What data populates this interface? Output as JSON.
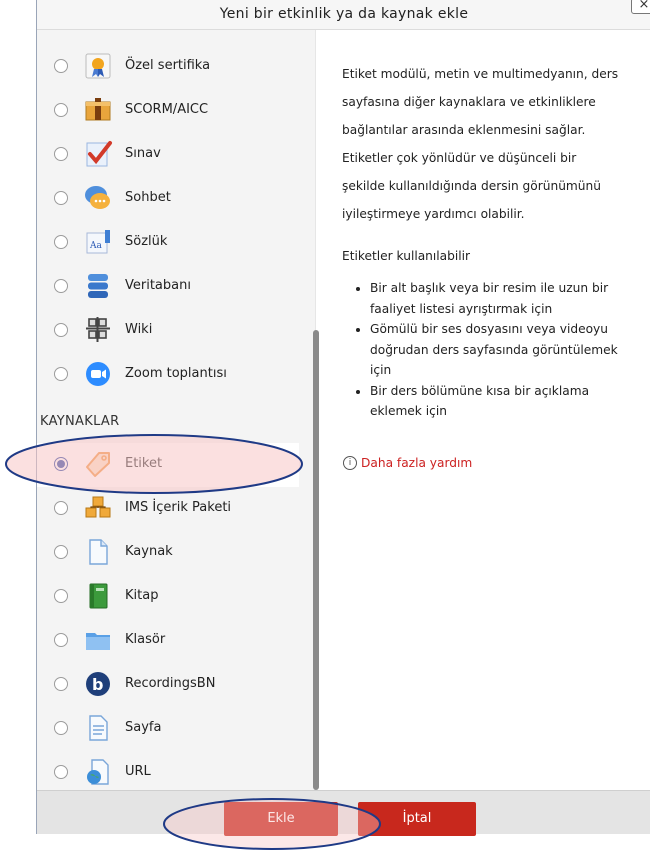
{
  "dialog": {
    "title": "Yeni bir etkinlik ya da kaynak ekle",
    "close_label": "×"
  },
  "list": {
    "activities": [
      {
        "label": "Özel sertifika",
        "icon": "certificate-icon"
      },
      {
        "label": "SCORM/AICC",
        "icon": "scorm-package-icon"
      },
      {
        "label": "Sınav",
        "icon": "quiz-checkmark-icon"
      },
      {
        "label": "Sohbet",
        "icon": "chat-bubbles-icon"
      },
      {
        "label": "Sözlük",
        "icon": "glossary-icon"
      },
      {
        "label": "Veritabanı",
        "icon": "database-icon"
      },
      {
        "label": "Wiki",
        "icon": "wiki-icon"
      },
      {
        "label": "Zoom toplantısı",
        "icon": "zoom-camera-icon"
      }
    ],
    "resources_heading": "KAYNAKLAR",
    "resources": [
      {
        "label": "Etiket",
        "icon": "label-tag-icon",
        "selected": true
      },
      {
        "label": "IMS İçerik Paketi",
        "icon": "ims-package-icon"
      },
      {
        "label": "Kaynak",
        "icon": "file-icon"
      },
      {
        "label": "Kitap",
        "icon": "book-icon"
      },
      {
        "label": "Klasör",
        "icon": "folder-icon"
      },
      {
        "label": "RecordingsBN",
        "icon": "bigbluebutton-icon"
      },
      {
        "label": "Sayfa",
        "icon": "page-icon"
      },
      {
        "label": "URL",
        "icon": "url-globe-icon"
      }
    ]
  },
  "description": {
    "p1": "Etiket modülü, metin ve multimedyanın, ders sayfasına diğer kaynaklara ve etkinliklere bağlantılar arasında eklenmesini sağlar. Etiketler çok yönlüdür ve düşünceli bir şekilde kullanıldığında dersin görünümünü iyileştirmeye yardımcı olabilir.",
    "p2": "Etiketler kullanılabilir",
    "bullets": [
      "Bir alt başlık veya bir resim ile uzun bir faaliyet listesi ayrıştırmak için",
      "Gömülü bir ses dosyasını veya videoyu doğrudan ders sayfasında görüntülemek için",
      "Bir ders bölümüne kısa bir açıklama eklemek için"
    ],
    "help_icon": "i",
    "help_link": "Daha fazla yardım"
  },
  "footer": {
    "add_label": "Ekle",
    "cancel_label": "İptal"
  },
  "colors": {
    "button_red": "#c8281d",
    "help_red": "#cc2121",
    "annotation_blue": "#1f3a86",
    "highlight_pink": "#f7c6c6"
  }
}
